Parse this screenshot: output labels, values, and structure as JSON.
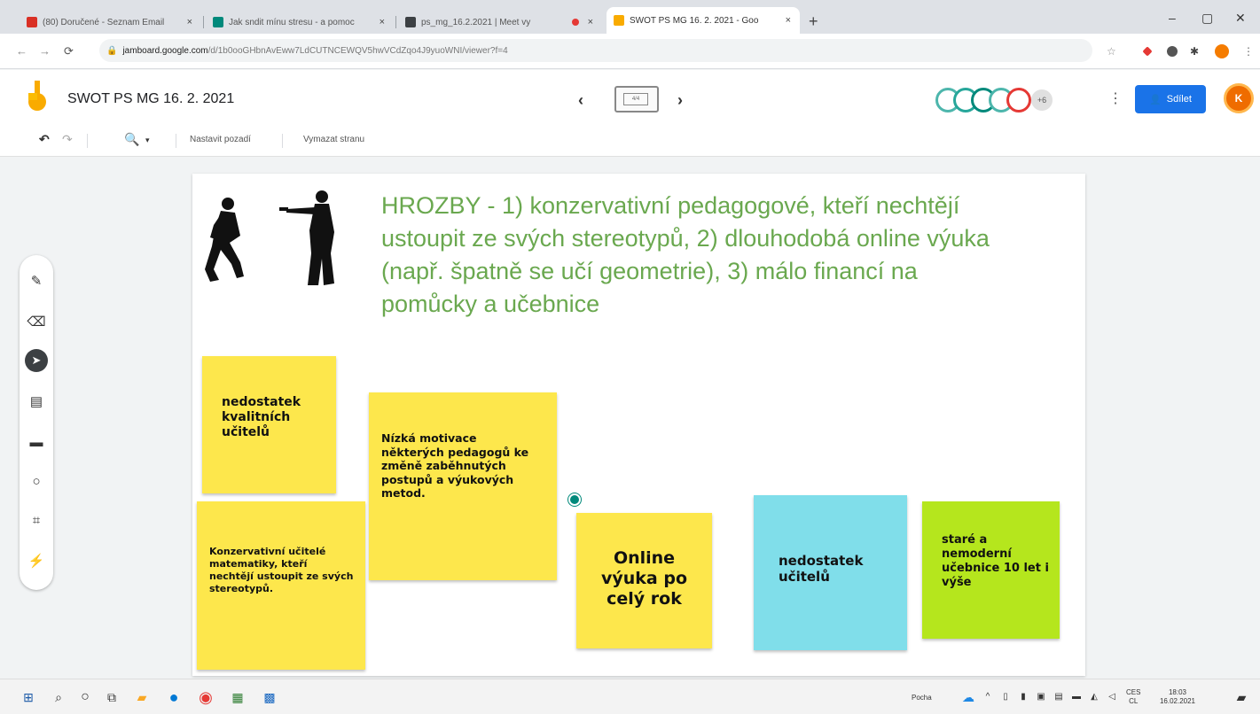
{
  "browser": {
    "tabs": [
      {
        "title": "(80) Doručené - Seznam Email",
        "color": "#d93025"
      },
      {
        "title": "Jak sndit mínu stresu - a pomoc",
        "color": "#00897b"
      },
      {
        "title": "ps_mg_16.2.2021 | Meet vy",
        "color": "#3c4043"
      },
      {
        "title": "SWOT PS MG 16. 2. 2021 - Goo",
        "color": "#f9ab00"
      }
    ],
    "new_tab": "+",
    "close_glyph": "×",
    "url_domain": "jamboard.google.com",
    "url_path": "/d/1b0ooGHbnAvEww7LdCUTNCEWQV5hwVCdZqo4J9yuoWNI/viewer?f=4",
    "window_controls": [
      "–",
      "▢",
      "✕"
    ]
  },
  "jamboard": {
    "title": "SWOT PS MG 16. 2. 2021",
    "frame_prev": "‹",
    "frame_next": "›",
    "frame_label": "4/4",
    "collaborators_more": "+6",
    "share_label": "Sdílet",
    "user_initial": "K",
    "toolbar": {
      "set_background": "Nastavit pozadí",
      "clear_frame": "Vymazat stranu"
    },
    "heading": "HROZBY - 1) konzervativní pedagogové, kteří nechtějí ustoupit ze svých stereotypů, 2) dlouhodobá online výuka (např. špatně se učí geometrie), 3) málo financí na pomůcky a učebnice",
    "notes": [
      {
        "text": "nedostatek kvalitních učitelů",
        "color": "#fde74c"
      },
      {
        "text": "Nízká motivace některých pedagogů ke změně zaběhnutých postupů a výukových metod.",
        "color": "#fde74c"
      },
      {
        "text": "Konzervativní učitelé matematiky, kteří nechtějí ustoupit ze svých stereotypů.",
        "color": "#fde74c"
      },
      {
        "text": "Online výuka po celý rok",
        "color": "#fde74c"
      },
      {
        "text": "nedostatek učitelů",
        "color": "#80deea"
      },
      {
        "text": "staré a nemoderní učebnice 10 let i výše",
        "color": "#b5e61d"
      }
    ]
  },
  "taskbar": {
    "weather": "Pocha",
    "lang_top": "CES",
    "lang_bottom": "CL",
    "time": "18:03",
    "date": "16.02.2021"
  }
}
